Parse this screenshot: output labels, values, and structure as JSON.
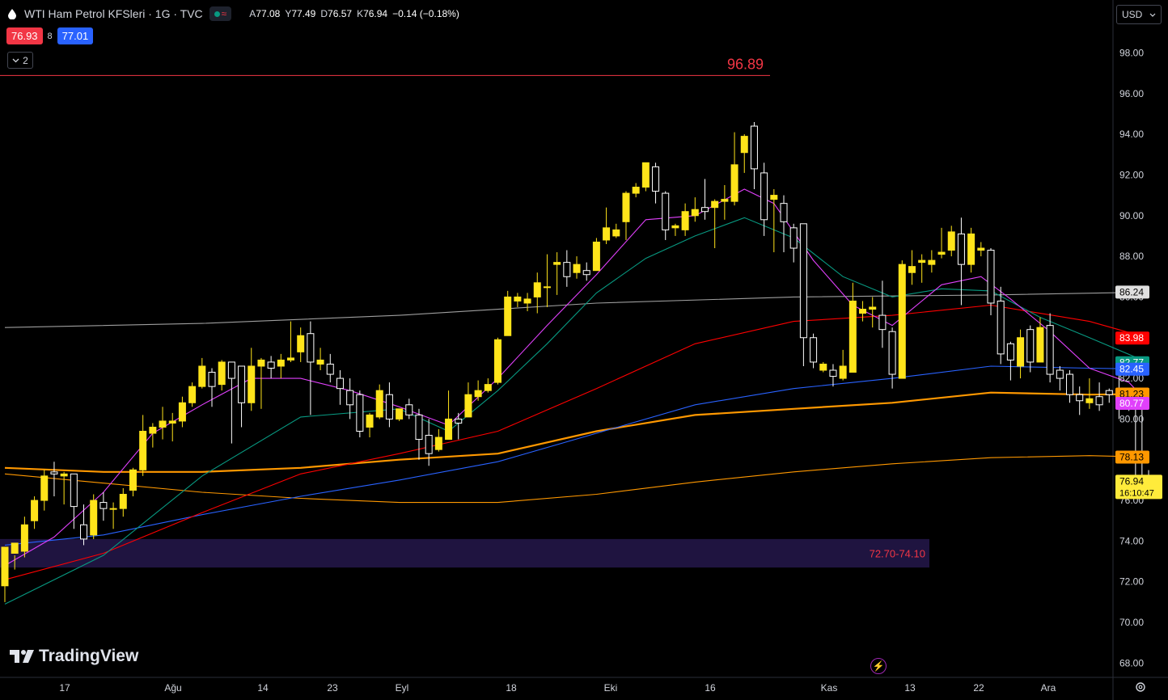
{
  "header": {
    "title": "WTI Ham Petrol KFSleri · 1G · TVC",
    "ohlc": {
      "o_label": "A",
      "o": "77.08",
      "h_label": "Y",
      "h": "77.49",
      "l_label": "D",
      "l": "76.57",
      "c_label": "K",
      "c": "76.94",
      "change": "−0.14 (−0.18%)"
    },
    "sell_price": "76.93",
    "spread": "8",
    "buy_price": "77.01",
    "collapse_count": "2",
    "currency": "USD"
  },
  "branding": {
    "logo_text": "TradingView"
  },
  "colors": {
    "background": "#000000",
    "candle_up": "#ffe41a",
    "candle_down": "#000000",
    "candle_down_border": "#ffffff",
    "ema_10": "#e040fb",
    "ema_20": "#089981",
    "ema_50": "#ff0000",
    "ema_100": "#2962ff",
    "ema_200": "#ff9800",
    "ma_long": "#9e9e9e",
    "ma_slow": "#ff9800",
    "zone": "#1f1440",
    "resistance": "#f23645"
  },
  "chart_data": {
    "type": "candlestick",
    "x_ticks": [
      "17",
      "Ağu",
      "14",
      "23",
      "Eyl",
      "18",
      "Eki",
      "16",
      "Kas",
      "13",
      "22",
      "Ara"
    ],
    "y_ticks": [
      "68.00",
      "70.00",
      "72.00",
      "74.00",
      "76.00",
      "78.00",
      "80.00",
      "82.00",
      "84.00",
      "86.00",
      "88.00",
      "90.00",
      "92.00",
      "94.00",
      "96.00",
      "98.00"
    ],
    "ylim": [
      68,
      98
    ],
    "scale_min": 67.3,
    "scale_max": 100.6,
    "candles": [
      [
        71.8,
        73.7,
        71.0,
        73.4
      ],
      [
        73.4,
        73.9,
        72.6,
        73.3
      ],
      [
        73.5,
        74.8,
        73.2,
        75.2
      ],
      [
        75.0,
        76.0,
        74.6,
        76.2
      ],
      [
        76.0,
        77.2,
        75.5,
        77.5
      ],
      [
        77.4,
        77.3,
        76.2,
        77.9
      ],
      [
        77.2,
        77.3,
        75.8,
        77.4
      ],
      [
        77.3,
        75.7,
        74.6,
        77.2
      ],
      [
        74.8,
        74.1,
        73.8,
        75.8
      ],
      [
        74.3,
        76.0,
        74.1,
        76.3
      ],
      [
        75.9,
        75.6,
        75.0,
        76.4
      ],
      [
        75.6,
        75.6,
        74.6,
        75.9
      ],
      [
        75.6,
        76.3,
        75.2,
        76.6
      ],
      [
        76.5,
        77.5,
        76.2,
        77.6
      ],
      [
        77.5,
        79.4,
        77.2,
        80.2
      ],
      [
        79.3,
        79.6,
        78.6,
        79.8
      ],
      [
        79.6,
        79.9,
        79.0,
        80.6
      ],
      [
        79.8,
        79.9,
        78.9,
        80.3
      ],
      [
        79.9,
        80.8,
        79.6,
        81.1
      ],
      [
        80.8,
        81.6,
        80.6,
        81.8
      ],
      [
        81.6,
        82.6,
        81.5,
        83.0
      ],
      [
        82.3,
        81.6,
        80.6,
        82.5
      ],
      [
        81.7,
        82.8,
        81.4,
        82.9
      ],
      [
        82.8,
        82.0,
        78.8,
        82.7
      ],
      [
        82.6,
        80.8,
        79.6,
        82.6
      ],
      [
        80.8,
        82.6,
        80.4,
        83.5
      ],
      [
        82.6,
        82.9,
        80.5,
        83.0
      ],
      [
        82.8,
        82.5,
        82.0,
        83.1
      ],
      [
        82.6,
        82.9,
        82.0,
        83.2
      ],
      [
        82.9,
        83.0,
        82.8,
        84.8
      ],
      [
        83.3,
        84.1,
        82.8,
        84.5
      ],
      [
        84.2,
        82.8,
        80.2,
        84.8
      ],
      [
        82.7,
        82.9,
        82.4,
        83.5
      ],
      [
        82.7,
        82.2,
        81.8,
        83.2
      ],
      [
        82.0,
        81.5,
        80.7,
        82.4
      ],
      [
        81.4,
        80.7,
        80.0,
        82.0
      ],
      [
        81.2,
        79.4,
        79.1,
        81.4
      ],
      [
        79.6,
        80.2,
        79.1,
        80.3
      ],
      [
        80.1,
        81.4,
        80.0,
        81.7
      ],
      [
        81.2,
        80.0,
        79.6,
        81.8
      ],
      [
        80.0,
        80.5,
        79.9,
        80.5
      ],
      [
        80.7,
        80.2,
        80.0,
        81.0
      ],
      [
        80.2,
        79.0,
        78.0,
        80.5
      ],
      [
        79.2,
        78.3,
        77.7,
        80.0
      ],
      [
        78.5,
        79.1,
        78.4,
        79.5
      ],
      [
        79.0,
        80.0,
        79.6,
        81.4
      ],
      [
        80.0,
        79.8,
        79.0,
        80.3
      ],
      [
        80.1,
        81.2,
        80.1,
        81.8
      ],
      [
        81.1,
        81.4,
        80.9,
        81.9
      ],
      [
        81.4,
        81.7,
        81.3,
        82.0
      ],
      [
        81.8,
        83.9,
        81.7,
        84.0
      ],
      [
        84.1,
        86.0,
        84.1,
        86.3
      ],
      [
        85.8,
        86.0,
        85.5,
        86.2
      ],
      [
        85.7,
        85.9,
        85.3,
        86.2
      ],
      [
        86.0,
        86.7,
        85.2,
        87.2
      ],
      [
        86.5,
        86.5,
        85.5,
        88.1
      ],
      [
        87.6,
        87.7,
        86.1,
        88.2
      ],
      [
        87.7,
        87.0,
        86.5,
        88.3
      ],
      [
        87.2,
        87.6,
        86.9,
        88.0
      ],
      [
        87.3,
        87.1,
        86.8,
        87.7
      ],
      [
        87.3,
        88.7,
        87.5,
        88.9
      ],
      [
        88.8,
        89.4,
        88.6,
        90.4
      ],
      [
        89.0,
        89.3,
        88.9,
        89.6
      ],
      [
        89.7,
        91.1,
        88.8,
        91.2
      ],
      [
        91.1,
        91.4,
        90.9,
        91.6
      ],
      [
        91.4,
        92.6,
        91.2,
        92.6
      ],
      [
        92.4,
        91.2,
        90.6,
        92.6
      ],
      [
        91.1,
        89.3,
        88.8,
        91.2
      ],
      [
        89.4,
        89.5,
        89.0,
        89.6
      ],
      [
        89.3,
        90.2,
        89.0,
        90.6
      ],
      [
        90.0,
        90.3,
        89.7,
        90.9
      ],
      [
        90.4,
        90.2,
        89.8,
        91.8
      ],
      [
        90.4,
        90.7,
        88.4,
        90.8
      ],
      [
        90.7,
        90.8,
        89.8,
        91.5
      ],
      [
        90.7,
        92.5,
        90.5,
        94.1
      ],
      [
        93.1,
        93.9,
        92.1,
        94.0
      ],
      [
        94.4,
        92.3,
        91.3,
        94.6
      ],
      [
        92.1,
        89.8,
        89.0,
        92.6
      ],
      [
        90.8,
        91.0,
        88.2,
        91.3
      ],
      [
        90.6,
        89.7,
        88.2,
        91.0
      ],
      [
        89.4,
        88.4,
        87.7,
        89.6
      ],
      [
        89.6,
        84.0,
        82.6,
        89.4
      ],
      [
        84.0,
        82.8,
        82.5,
        84.2
      ],
      [
        82.4,
        82.7,
        82.3,
        82.8
      ],
      [
        82.4,
        82.1,
        81.6,
        82.7
      ],
      [
        82.0,
        82.6,
        81.9,
        83.4
      ],
      [
        82.3,
        85.8,
        85.0,
        86.7
      ],
      [
        85.2,
        85.4,
        84.8,
        85.8
      ],
      [
        85.4,
        85.5,
        84.5,
        86.0
      ],
      [
        85.1,
        84.4,
        83.5,
        86.8
      ],
      [
        84.3,
        82.2,
        81.5,
        84.5
      ],
      [
        82.0,
        87.6,
        82.2,
        87.8
      ],
      [
        87.2,
        87.5,
        86.6,
        88.3
      ],
      [
        87.7,
        87.8,
        86.7,
        88.1
      ],
      [
        87.6,
        87.8,
        87.2,
        88.3
      ],
      [
        88.1,
        88.2,
        87.9,
        89.4
      ],
      [
        88.3,
        89.2,
        88.0,
        89.5
      ],
      [
        89.1,
        87.6,
        85.6,
        89.9
      ],
      [
        87.6,
        89.1,
        87.2,
        89.4
      ],
      [
        88.3,
        88.4,
        88.0,
        88.7
      ],
      [
        88.3,
        85.7,
        85.1,
        88.4
      ],
      [
        85.8,
        83.2,
        82.7,
        86.5
      ],
      [
        83.7,
        82.9,
        81.9,
        83.8
      ],
      [
        82.6,
        84.0,
        82.0,
        84.4
      ],
      [
        84.4,
        82.8,
        82.3,
        84.6
      ],
      [
        82.8,
        84.5,
        84.2,
        85.0
      ],
      [
        84.6,
        82.2,
        81.8,
        85.2
      ],
      [
        82.4,
        82.0,
        81.4,
        82.6
      ],
      [
        82.2,
        81.2,
        80.8,
        82.4
      ],
      [
        81.2,
        80.9,
        80.2,
        81.6
      ],
      [
        80.8,
        81.0,
        80.5,
        82.0
      ],
      [
        81.1,
        80.7,
        80.4,
        81.8
      ],
      [
        81.4,
        81.2,
        80.8,
        81.5
      ],
      [
        81.3,
        80.9,
        80.0,
        82.5
      ],
      [
        81.0,
        80.7,
        80.4,
        81.2
      ],
      [
        80.8,
        77.1,
        77.0,
        80.9
      ],
      [
        77.08,
        76.94,
        76.57,
        77.49
      ]
    ],
    "series": [
      {
        "color_key": "ma_long",
        "points": [
          [
            0,
            84.5
          ],
          [
            20,
            84.7
          ],
          [
            40,
            85.1
          ],
          [
            60,
            85.7
          ],
          [
            80,
            86.0
          ],
          [
            100,
            86.1
          ],
          [
            116,
            86.24
          ]
        ]
      },
      {
        "color_key": "ema_200",
        "points": [
          [
            0,
            77.6
          ],
          [
            10,
            77.4
          ],
          [
            20,
            77.4
          ],
          [
            30,
            77.6
          ],
          [
            40,
            78.0
          ],
          [
            50,
            78.3
          ],
          [
            60,
            79.4
          ],
          [
            70,
            80.2
          ],
          [
            80,
            80.5
          ],
          [
            90,
            80.8
          ],
          [
            100,
            81.3
          ],
          [
            110,
            81.2
          ],
          [
            116,
            81.23
          ]
        ]
      },
      {
        "color_key": "ma_slow",
        "points": [
          [
            0,
            77.3
          ],
          [
            20,
            76.4
          ],
          [
            30,
            76.1
          ],
          [
            40,
            75.9
          ],
          [
            50,
            75.9
          ],
          [
            60,
            76.3
          ],
          [
            70,
            76.9
          ],
          [
            80,
            77.4
          ],
          [
            90,
            77.8
          ],
          [
            100,
            78.1
          ],
          [
            110,
            78.2
          ],
          [
            116,
            78.13
          ]
        ]
      },
      {
        "color_key": "ema_100",
        "points": [
          [
            0,
            73.8
          ],
          [
            10,
            74.3
          ],
          [
            20,
            75.3
          ],
          [
            30,
            76.2
          ],
          [
            40,
            77.0
          ],
          [
            50,
            77.9
          ],
          [
            60,
            79.3
          ],
          [
            70,
            80.7
          ],
          [
            80,
            81.5
          ],
          [
            90,
            82.0
          ],
          [
            100,
            82.6
          ],
          [
            110,
            82.5
          ],
          [
            116,
            82.45
          ]
        ]
      },
      {
        "color_key": "ema_50",
        "points": [
          [
            0,
            72.1
          ],
          [
            10,
            73.4
          ],
          [
            20,
            75.4
          ],
          [
            30,
            77.3
          ],
          [
            40,
            78.3
          ],
          [
            50,
            79.4
          ],
          [
            60,
            81.5
          ],
          [
            70,
            83.7
          ],
          [
            80,
            84.8
          ],
          [
            90,
            85.1
          ],
          [
            100,
            85.6
          ],
          [
            110,
            84.8
          ],
          [
            116,
            83.98
          ]
        ]
      },
      {
        "color_key": "ema_20",
        "points": [
          [
            0,
            70.9
          ],
          [
            10,
            73.3
          ],
          [
            20,
            77.2
          ],
          [
            30,
            80.1
          ],
          [
            40,
            80.5
          ],
          [
            45,
            79.4
          ],
          [
            50,
            81.4
          ],
          [
            55,
            83.7
          ],
          [
            60,
            86.2
          ],
          [
            65,
            87.9
          ],
          [
            70,
            89.0
          ],
          [
            75,
            89.9
          ],
          [
            80,
            88.9
          ],
          [
            85,
            87.0
          ],
          [
            90,
            86.0
          ],
          [
            95,
            86.4
          ],
          [
            100,
            86.3
          ],
          [
            105,
            85.0
          ],
          [
            110,
            84.0
          ],
          [
            116,
            82.77
          ]
        ]
      },
      {
        "color_key": "ema_10",
        "points": [
          [
            0,
            72.8
          ],
          [
            5,
            74.2
          ],
          [
            10,
            76.4
          ],
          [
            15,
            79.3
          ],
          [
            20,
            80.7
          ],
          [
            25,
            82.0
          ],
          [
            30,
            82.0
          ],
          [
            35,
            81.4
          ],
          [
            40,
            80.6
          ],
          [
            45,
            79.7
          ],
          [
            50,
            82.0
          ],
          [
            55,
            84.6
          ],
          [
            60,
            87.1
          ],
          [
            65,
            89.8
          ],
          [
            70,
            90.0
          ],
          [
            75,
            91.3
          ],
          [
            78,
            90.6
          ],
          [
            82,
            87.8
          ],
          [
            86,
            85.6
          ],
          [
            90,
            84.6
          ],
          [
            95,
            86.6
          ],
          [
            99,
            87.0
          ],
          [
            102,
            85.9
          ],
          [
            106,
            84.3
          ],
          [
            110,
            82.5
          ],
          [
            114,
            81.8
          ],
          [
            116,
            80.77
          ]
        ]
      }
    ],
    "resistance": {
      "price": 96.89,
      "label": "96.89"
    },
    "zone": {
      "low": 72.7,
      "high": 74.1,
      "label": "72.70-74.10"
    },
    "price_labels": [
      {
        "value": 86.24,
        "text": "86.24",
        "bg": "#e0e0e0",
        "fg": "#000000"
      },
      {
        "value": 83.98,
        "text": "83.98",
        "bg": "#ff0000",
        "fg": "#ffffff"
      },
      {
        "value": 82.77,
        "text": "82.77",
        "bg": "#089981",
        "fg": "#ffffff"
      },
      {
        "value": 82.45,
        "text": "82.45",
        "bg": "#2962ff",
        "fg": "#ffffff"
      },
      {
        "value": 81.23,
        "text": "81.23",
        "bg": "#ff9800",
        "fg": "#000000"
      },
      {
        "value": 80.77,
        "text": "80.77",
        "bg": "#e040fb",
        "fg": "#ffffff"
      },
      {
        "value": 78.13,
        "text": "78.13",
        "bg": "#ff9800",
        "fg": "#000000"
      }
    ],
    "last_price": {
      "value": 76.94,
      "text": "76.94",
      "countdown": "16:10:47"
    }
  }
}
